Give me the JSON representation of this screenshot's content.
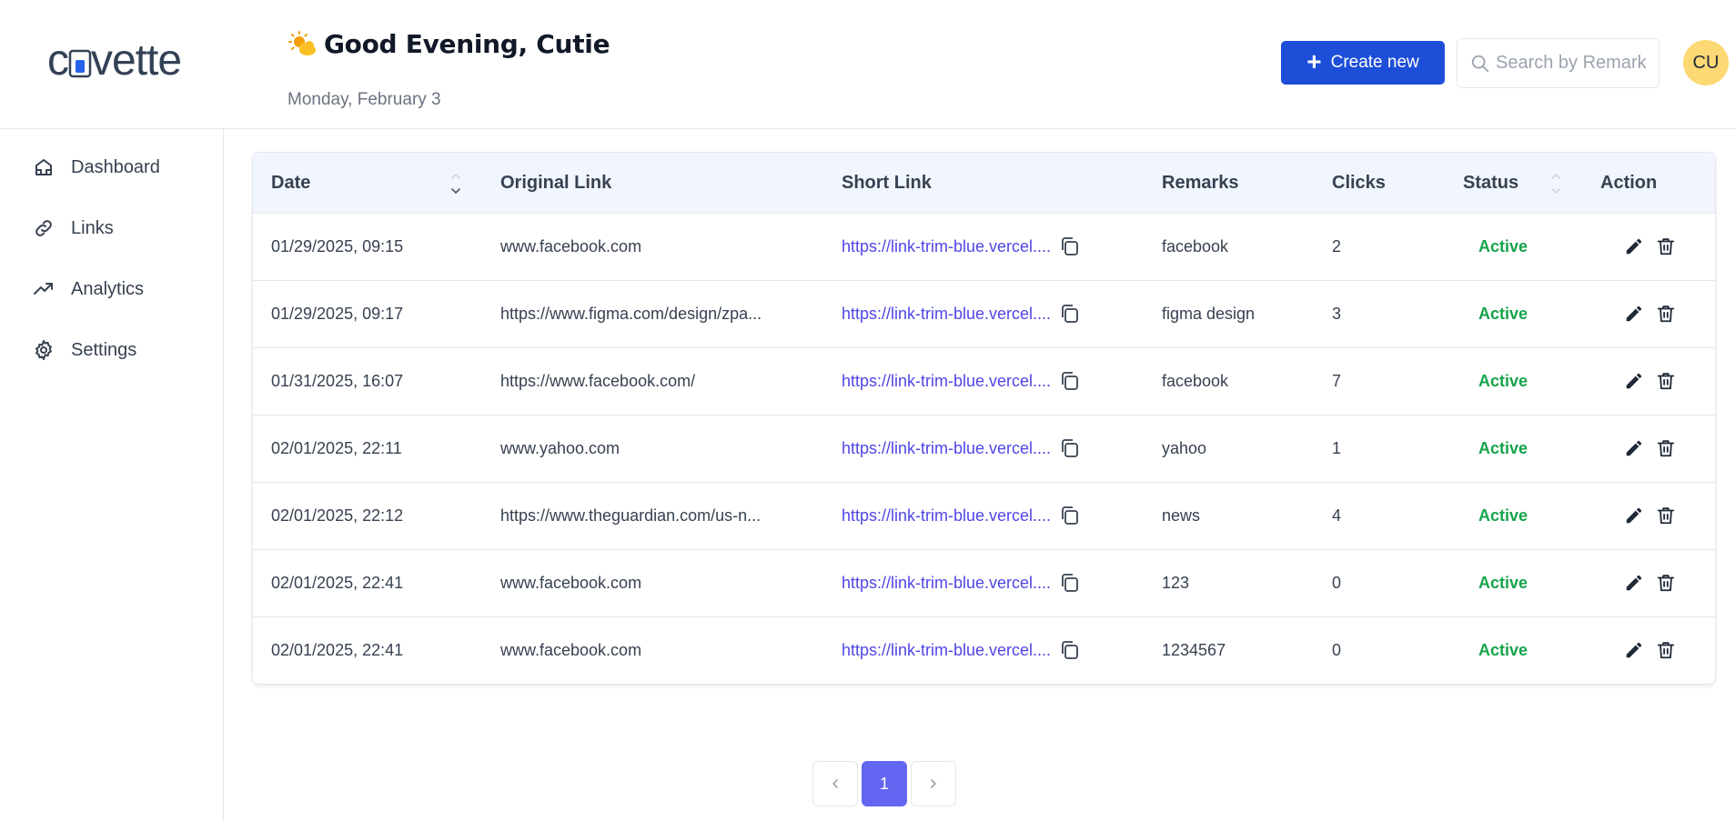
{
  "brand": {
    "logo_text": "cuvette",
    "accent": "#1d4ed8"
  },
  "header": {
    "greeting": "Good Evening, Cutie",
    "greeting_icon": "sun-cloud-icon",
    "date": "Monday, February 3",
    "create_label": "Create new",
    "search_placeholder": "Search by Remark",
    "avatar_initials": "CU"
  },
  "sidebar": {
    "items": [
      {
        "label": "Dashboard",
        "icon": "home-icon"
      },
      {
        "label": "Links",
        "icon": "link-icon"
      },
      {
        "label": "Analytics",
        "icon": "trending-up-icon"
      },
      {
        "label": "Settings",
        "icon": "gear-icon"
      }
    ]
  },
  "table": {
    "columns": [
      "Date",
      "Original Link",
      "Short Link",
      "Remarks",
      "Clicks",
      "Status",
      "Action"
    ],
    "rows": [
      {
        "date": "01/29/2025, 09:15",
        "original": "www.facebook.com",
        "short": "https://link-trim-blue.vercel....",
        "remarks": "facebook",
        "clicks": "2",
        "status": "Active"
      },
      {
        "date": "01/29/2025, 09:17",
        "original": "https://www.figma.com/design/zpa...",
        "short": "https://link-trim-blue.vercel....",
        "remarks": "figma design",
        "clicks": "3",
        "status": "Active"
      },
      {
        "date": "01/31/2025, 16:07",
        "original": "https://www.facebook.com/",
        "short": "https://link-trim-blue.vercel....",
        "remarks": "facebook",
        "clicks": "7",
        "status": "Active"
      },
      {
        "date": "02/01/2025, 22:11",
        "original": "www.yahoo.com",
        "short": "https://link-trim-blue.vercel....",
        "remarks": "yahoo",
        "clicks": "1",
        "status": "Active"
      },
      {
        "date": "02/01/2025, 22:12",
        "original": "https://www.theguardian.com/us-n...",
        "short": "https://link-trim-blue.vercel....",
        "remarks": "news",
        "clicks": "4",
        "status": "Active"
      },
      {
        "date": "02/01/2025, 22:41",
        "original": "www.facebook.com",
        "short": "https://link-trim-blue.vercel....",
        "remarks": "123",
        "clicks": "0",
        "status": "Active"
      },
      {
        "date": "02/01/2025, 22:41",
        "original": "www.facebook.com",
        "short": "https://link-trim-blue.vercel....",
        "remarks": "1234567",
        "clicks": "0",
        "status": "Active"
      }
    ]
  },
  "pagination": {
    "current_page": "1"
  },
  "colors": {
    "primary": "#1d4ed8",
    "page_active": "#6366f1",
    "status_active": "#16a34a",
    "short_link": "#4f46e5",
    "avatar_bg": "#fcd975"
  }
}
